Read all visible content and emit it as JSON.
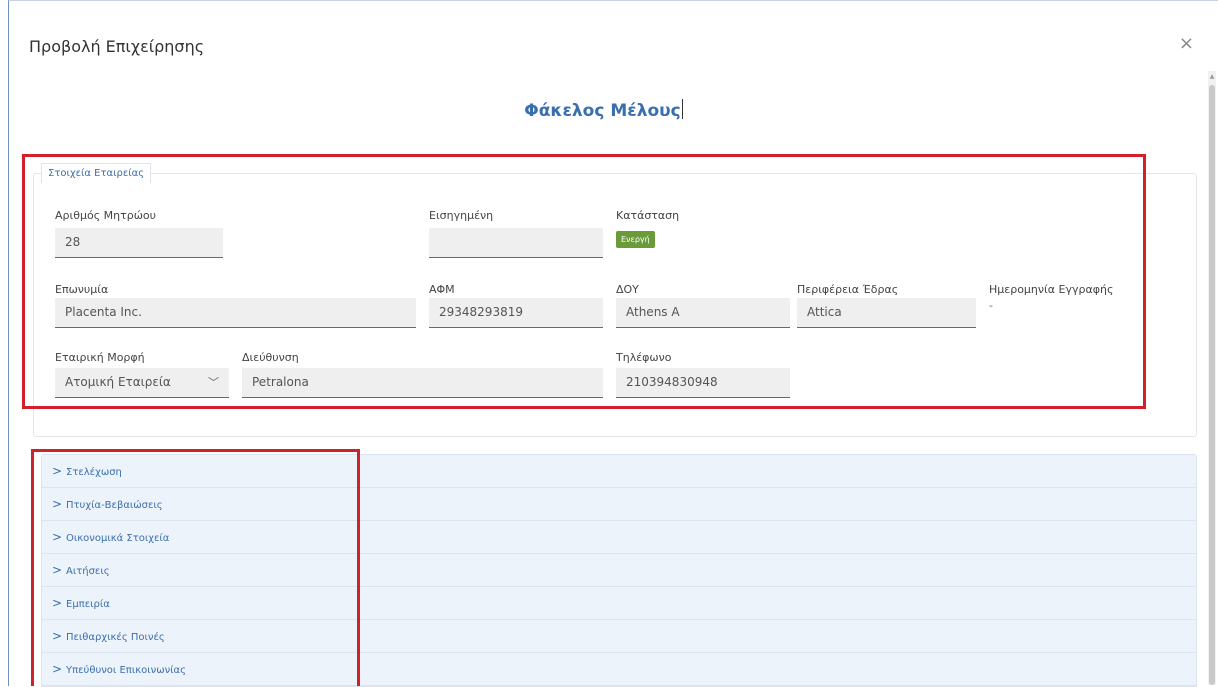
{
  "modal": {
    "title": "Προβολή Επιχείρησης",
    "close_glyph": "×",
    "heading": "Φάκελος Μέλους"
  },
  "company_panel": {
    "legend": "Στοιχεία Εταιρείας",
    "fields": {
      "registry_number": {
        "label": "Αριθμός Μητρώου",
        "value": "28"
      },
      "recommended": {
        "label": "Εισηγημένη",
        "value": ""
      },
      "status": {
        "label": "Κατάσταση",
        "badge": "Ενεργή",
        "badge_color": "#6a9a3a"
      },
      "name": {
        "label": "Επωνυμία",
        "value": "Placenta Inc."
      },
      "afm": {
        "label": "ΑΦΜ",
        "value": "29348293819"
      },
      "doy": {
        "label": "ΔΟΥ",
        "value": "Athens A"
      },
      "region": {
        "label": "Περιφέρεια Έδρας",
        "value": "Attica"
      },
      "registration_date": {
        "label": "Ημερομηνία Εγγραφής",
        "value": "-"
      },
      "company_form": {
        "label": "Εταιρική Μορφή",
        "value": "Ατομική Εταιρεία"
      },
      "address": {
        "label": "Διεύθυνση",
        "value": "Petralona"
      },
      "phone": {
        "label": "Τηλέφωνο",
        "value": "210394830948"
      }
    }
  },
  "accordion": {
    "chevron": ">",
    "items": [
      "Στελέχωση",
      "Πτυχία-Βεβαιώσεις",
      "Οικονομικά Στοιχεία",
      "Αιτήσεις",
      "Εμπειρία",
      "Πειθαρχικές Ποινές",
      "Υπεύθυνοι Επικοινωνίας"
    ]
  },
  "colors": {
    "accent": "#3a6fae",
    "highlight_frame": "#d0202a"
  }
}
